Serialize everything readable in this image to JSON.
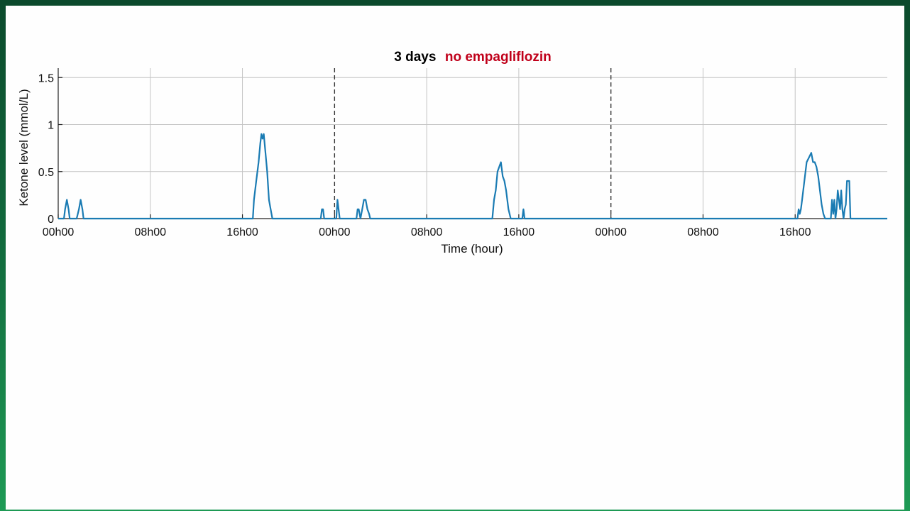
{
  "chart_data": {
    "type": "line",
    "title": "3 days",
    "subtitle": "no empagliflozin",
    "xlabel": "Time (hour)",
    "ylabel": "Ketone level (mmol/L)",
    "xlim": [
      0,
      72
    ],
    "ylim": [
      0,
      1.6
    ],
    "x_ticks": [
      0,
      8,
      16,
      24,
      32,
      40,
      48,
      56,
      64
    ],
    "x_tick_labels": [
      "00h00",
      "08h00",
      "16h00",
      "00h00",
      "08h00",
      "16h00",
      "00h00",
      "08h00",
      "16h00"
    ],
    "y_ticks": [
      0,
      0.5,
      1,
      1.5
    ],
    "y_tick_labels": [
      "0",
      "0.5",
      "1",
      "1.5"
    ],
    "day_boundaries": [
      24,
      48
    ],
    "grid": true,
    "series": [
      {
        "color": "#1a7bb3",
        "x": [
          0,
          0.5,
          0.6,
          0.75,
          0.9,
          1.0,
          1.6,
          1.8,
          1.95,
          2.1,
          2.2,
          16.9,
          17.0,
          17.2,
          17.4,
          17.55,
          17.65,
          17.75,
          17.85,
          18.0,
          18.15,
          18.3,
          18.45,
          18.6,
          22.8,
          22.9,
          23.0,
          23.1,
          24.15,
          24.25,
          24.35,
          24.45,
          25.9,
          26.0,
          26.1,
          26.25,
          26.4,
          26.55,
          26.7,
          26.85,
          27.0,
          27.1,
          37.7,
          37.85,
          38.0,
          38.15,
          38.3,
          38.45,
          38.6,
          38.75,
          38.9,
          39.1,
          39.3,
          40.3,
          40.4,
          40.5,
          64.2,
          64.3,
          64.4,
          64.5,
          64.6,
          64.8,
          65.0,
          65.2,
          65.4,
          65.55,
          65.7,
          65.85,
          66.0,
          66.15,
          66.3,
          66.45,
          66.6,
          67.1,
          67.2,
          67.3,
          67.4,
          67.5,
          67.6,
          67.7,
          67.8,
          67.9,
          68.0,
          68.1,
          68.2,
          68.3,
          68.4,
          68.5,
          68.6,
          68.7,
          68.8,
          69.0,
          72
        ],
        "y": [
          0,
          0,
          0.1,
          0.2,
          0.1,
          0,
          0,
          0.1,
          0.2,
          0.1,
          0,
          0,
          0.2,
          0.4,
          0.6,
          0.8,
          0.9,
          0.85,
          0.9,
          0.7,
          0.5,
          0.2,
          0.1,
          0,
          0,
          0.1,
          0.1,
          0,
          0,
          0.2,
          0.1,
          0,
          0,
          0.1,
          0.1,
          0,
          0.1,
          0.2,
          0.2,
          0.1,
          0.05,
          0,
          0,
          0.2,
          0.3,
          0.5,
          0.55,
          0.6,
          0.45,
          0.4,
          0.3,
          0.1,
          0,
          0,
          0.1,
          0,
          0,
          0.1,
          0.05,
          0.1,
          0.2,
          0.4,
          0.6,
          0.65,
          0.7,
          0.6,
          0.6,
          0.55,
          0.45,
          0.3,
          0.15,
          0.05,
          0,
          0,
          0.2,
          0.05,
          0.2,
          0,
          0.1,
          0.3,
          0.2,
          0.1,
          0.3,
          0.1,
          0,
          0.1,
          0.15,
          0.4,
          0.4,
          0.4,
          0,
          0,
          0
        ]
      }
    ]
  }
}
